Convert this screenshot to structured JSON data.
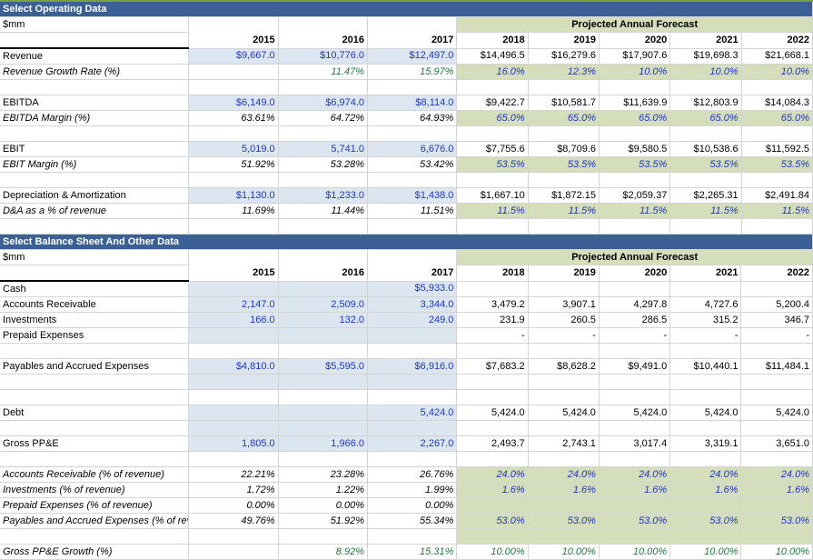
{
  "theme": {
    "section_bar_color": "#3a6096",
    "forecast_fill": "#d5debb",
    "historical_fill": "#dce6f1",
    "input_blue": "#1f36c7",
    "formula_green": "#1f7a3d",
    "top_strip": "#77a23e"
  },
  "section1": {
    "title": "Select Operating Data",
    "units": "$mm",
    "forecast_header": "Projected Annual Forecast",
    "years_hist": [
      "2015",
      "2016",
      "2017"
    ],
    "years_proj": [
      "2018",
      "2019",
      "2020",
      "2021",
      "2022"
    ],
    "rows": [
      {
        "label": "Revenue",
        "style": "plain",
        "hist": [
          "$9,667.0",
          "$10,776.0",
          "$12,497.0"
        ],
        "proj": [
          "$14,496.5",
          "$16,279.6",
          "$17,907.6",
          "$19,698.3",
          "$21,668.1"
        ]
      },
      {
        "label": "Revenue Growth Rate (%)",
        "style": "italic",
        "hist": [
          "",
          "11.47%",
          "15.97%"
        ],
        "proj": [
          "16.0%",
          "12.3%",
          "10.0%",
          "10.0%",
          "10.0%"
        ]
      },
      {
        "label": "",
        "style": "blank",
        "hist": [
          "",
          "",
          ""
        ],
        "proj": [
          "",
          "",
          "",
          "",
          ""
        ]
      },
      {
        "label": "EBITDA",
        "style": "plain",
        "hist": [
          "$6,149.0",
          "$6,974.0",
          "$8,114.0"
        ],
        "proj": [
          "$9,422.7",
          "$10,581.7",
          "$11,639.9",
          "$12,803.9",
          "$14,084.3"
        ]
      },
      {
        "label": "EBITDA Margin (%)",
        "style": "italic",
        "hist": [
          "63.61%",
          "64.72%",
          "64.93%"
        ],
        "proj": [
          "65.0%",
          "65.0%",
          "65.0%",
          "65.0%",
          "65.0%"
        ]
      },
      {
        "label": "",
        "style": "blank",
        "hist": [
          "",
          "",
          ""
        ],
        "proj": [
          "",
          "",
          "",
          "",
          ""
        ]
      },
      {
        "label": "EBIT",
        "style": "plain",
        "hist": [
          "5,019.0",
          "5,741.0",
          "6,676.0"
        ],
        "proj": [
          "$7,755.6",
          "$8,709.6",
          "$9,580.5",
          "$10,538.6",
          "$11,592.5"
        ]
      },
      {
        "label": "EBIT Margin (%)",
        "style": "italic",
        "hist": [
          "51.92%",
          "53.28%",
          "53.42%"
        ],
        "proj": [
          "53.5%",
          "53.5%",
          "53.5%",
          "53.5%",
          "53.5%"
        ]
      },
      {
        "label": "",
        "style": "blank",
        "hist": [
          "",
          "",
          ""
        ],
        "proj": [
          "",
          "",
          "",
          "",
          ""
        ]
      },
      {
        "label": "Depreciation & Amortization",
        "style": "plain",
        "hist": [
          "$1,130.0",
          "$1,233.0",
          "$1,438.0"
        ],
        "proj": [
          "$1,667.10",
          "$1,872.15",
          "$2,059.37",
          "$2,265.31",
          "$2,491.84"
        ]
      },
      {
        "label": "D&A as a % of revenue",
        "style": "italic",
        "hist": [
          "11.69%",
          "11.44%",
          "11.51%"
        ],
        "proj": [
          "11.5%",
          "11.5%",
          "11.5%",
          "11.5%",
          "11.5%"
        ]
      },
      {
        "label": "",
        "style": "blank",
        "hist": [
          "",
          "",
          ""
        ],
        "proj": [
          "",
          "",
          "",
          "",
          ""
        ]
      }
    ]
  },
  "section2": {
    "title": "Select Balance Sheet And Other Data",
    "units": "$mm",
    "forecast_header": "Projected Annual Forecast",
    "years_hist": [
      "2015",
      "2016",
      "2017"
    ],
    "years_proj": [
      "2018",
      "2019",
      "2020",
      "2021",
      "2022"
    ],
    "rows": [
      {
        "label": "Cash",
        "style": "plain",
        "hist": [
          "",
          "",
          "$5,933.0"
        ],
        "proj": [
          "",
          "",
          "",
          "",
          ""
        ]
      },
      {
        "label": "Accounts Receivable",
        "style": "plain",
        "hist": [
          "2,147.0",
          "2,509.0",
          "3,344.0"
        ],
        "proj": [
          "3,479.2",
          "3,907.1",
          "4,297.8",
          "4,727.6",
          "5,200.4"
        ]
      },
      {
        "label": "Investments",
        "style": "plain",
        "hist": [
          "166.0",
          "132.0",
          "249.0"
        ],
        "proj": [
          "231.9",
          "260.5",
          "286.5",
          "315.2",
          "346.7"
        ]
      },
      {
        "label": "Prepaid Expenses",
        "style": "plain",
        "hist": [
          "",
          "",
          ""
        ],
        "proj": [
          "-",
          "-",
          "-",
          "-",
          "-"
        ]
      },
      {
        "label": "",
        "style": "blank",
        "hist": [
          "",
          "",
          ""
        ],
        "proj": [
          "",
          "",
          "",
          "",
          ""
        ]
      },
      {
        "label": "Payables and Accrued Expenses",
        "style": "plain",
        "hist": [
          "$4,810.0",
          "$5,595.0",
          "$6,916.0"
        ],
        "proj": [
          "$7,683.2",
          "$8,628.2",
          "$9,491.0",
          "$10,440.1",
          "$11,484.1"
        ]
      },
      {
        "label": "",
        "style": "blank",
        "hist": [
          "",
          "",
          ""
        ],
        "proj": [
          "",
          "",
          "",
          "",
          ""
        ]
      },
      {
        "label": "",
        "style": "blank",
        "hist": [
          "",
          "",
          ""
        ],
        "proj": [
          "",
          "",
          "",
          "",
          ""
        ]
      },
      {
        "label": "Debt",
        "style": "plain",
        "hist": [
          "",
          "",
          "5,424.0"
        ],
        "proj": [
          "5,424.0",
          "5,424.0",
          "5,424.0",
          "5,424.0",
          "5,424.0"
        ]
      },
      {
        "label": "",
        "style": "blank",
        "hist": [
          "",
          "",
          ""
        ],
        "proj": [
          "",
          "",
          "",
          "",
          ""
        ]
      },
      {
        "label": "Gross PP&E",
        "style": "plain",
        "hist": [
          "1,805.0",
          "1,966.0",
          "2,267.0"
        ],
        "proj": [
          "2,493.7",
          "2,743.1",
          "3,017.4",
          "3,319.1",
          "3,651.0"
        ]
      },
      {
        "label": "",
        "style": "blank",
        "hist": [
          "",
          "",
          ""
        ],
        "proj": [
          "",
          "",
          "",
          "",
          ""
        ]
      },
      {
        "label": "Accounts Receivable (% of revenue)",
        "style": "italic-pct",
        "hist": [
          "22.21%",
          "23.28%",
          "26.76%"
        ],
        "proj": [
          "24.0%",
          "24.0%",
          "24.0%",
          "24.0%",
          "24.0%"
        ]
      },
      {
        "label": "Investments (% of revenue)",
        "style": "italic-pct",
        "hist": [
          "1.72%",
          "1.22%",
          "1.99%"
        ],
        "proj": [
          "1.6%",
          "1.6%",
          "1.6%",
          "1.6%",
          "1.6%"
        ]
      },
      {
        "label": "Prepaid Expenses (% of revenue)",
        "style": "italic-pct",
        "hist": [
          "0.00%",
          "0.00%",
          "0.00%"
        ],
        "proj": [
          "",
          "",
          "",
          "",
          ""
        ]
      },
      {
        "label": "Payables and Accrued Expenses (% of reve",
        "style": "italic-pct",
        "hist": [
          "49.76%",
          "51.92%",
          "55.34%"
        ],
        "proj": [
          "53.0%",
          "53.0%",
          "53.0%",
          "53.0%",
          "53.0%"
        ]
      },
      {
        "label": "",
        "style": "blank-pct",
        "hist": [
          "",
          "",
          ""
        ],
        "proj": [
          "",
          "",
          "",
          "",
          ""
        ]
      },
      {
        "label": "Gross PP&E Growth (%)",
        "style": "italic-growth",
        "hist": [
          "",
          "8.92%",
          "15.31%"
        ],
        "proj": [
          "10.00%",
          "10.00%",
          "10.00%",
          "10.00%",
          "10.00%"
        ]
      }
    ]
  }
}
